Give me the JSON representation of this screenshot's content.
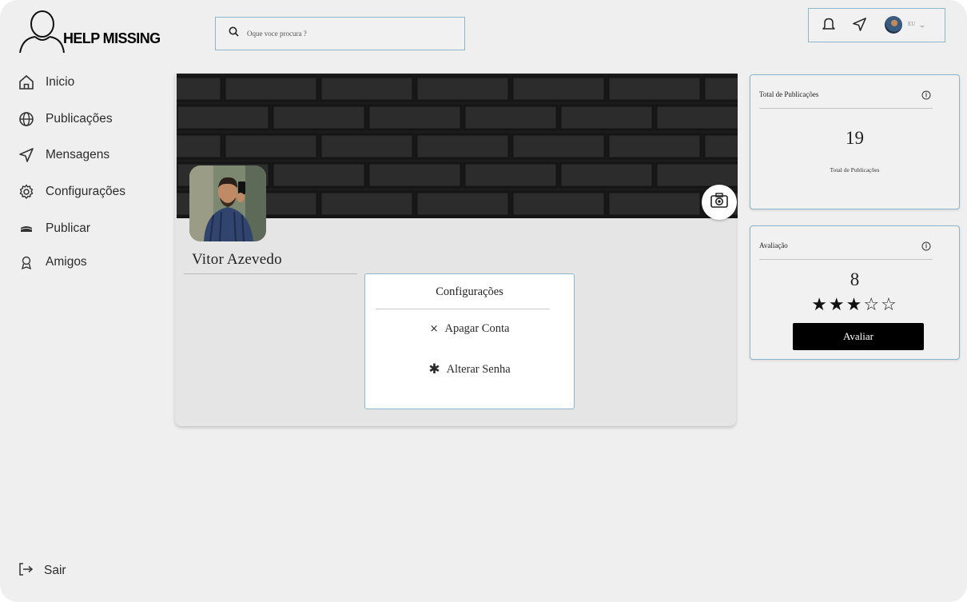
{
  "brand": {
    "name": "HELP MISSING"
  },
  "sidebar": {
    "items": [
      {
        "label": "Inicio",
        "icon": "home-icon"
      },
      {
        "label": "Publicações",
        "icon": "globe-icon"
      },
      {
        "label": "Mensagens",
        "icon": "send-icon"
      },
      {
        "label": "Configurações",
        "icon": "gear-icon"
      },
      {
        "label": "Publicar",
        "icon": "inbox-tray-icon"
      },
      {
        "label": "Amigos",
        "icon": "award-icon"
      }
    ],
    "logout_label": "Sair"
  },
  "search": {
    "placeholder": "Oque voce procura ?"
  },
  "topbar": {
    "user_label": "EU"
  },
  "profile": {
    "name": "Vitor Azevedo"
  },
  "settings_panel": {
    "title": "Configurações",
    "options": [
      {
        "glyph": "×",
        "label": "Apagar Conta"
      },
      {
        "glyph": "✱",
        "label": "Alterar Senha"
      }
    ]
  },
  "stats": {
    "publications": {
      "title": "Total de Publicações",
      "value": "19",
      "caption": "Total de Publicações"
    },
    "rating": {
      "title": "Avaliação",
      "value": "8",
      "stars_filled": 3,
      "stars_total": 5,
      "stars_display": "★★★☆☆",
      "button_label": "Avaliar"
    }
  },
  "colors": {
    "accent_border": "#8bb6cc",
    "background": "#efefef",
    "button_bg": "#000000"
  }
}
